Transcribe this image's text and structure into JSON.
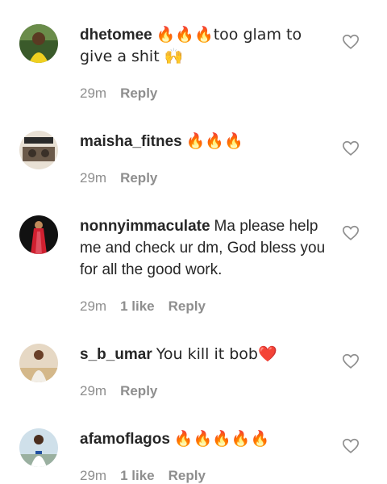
{
  "comments": [
    {
      "username": "dhetomee",
      "text": "🔥🔥🔥too glam to give a shit 🙌",
      "time": "29m",
      "likes": "",
      "reply": "Reply",
      "avatar_icon": "profile-photo-avatar"
    },
    {
      "username": "maisha_fitnes",
      "text": "🔥🔥🔥",
      "time": "29m",
      "likes": "",
      "reply": "Reply",
      "avatar_icon": "profile-photo-avatar"
    },
    {
      "username": "nonnyimmaculate",
      "text": "Ma please help me and check ur dm, God bless you for all the good work.",
      "time": "29m",
      "likes": "1 like",
      "reply": "Reply",
      "avatar_icon": "profile-photo-avatar"
    },
    {
      "username": "s_b_umar",
      "text": "You kill it bob❤️",
      "time": "29m",
      "likes": "",
      "reply": "Reply",
      "avatar_icon": "profile-photo-avatar"
    },
    {
      "username": "afamoflagos",
      "text": "🔥🔥🔥🔥🔥",
      "time": "29m",
      "likes": "1 like",
      "reply": "Reply",
      "avatar_icon": "profile-photo-avatar"
    }
  ],
  "colors": {
    "text": "#262626",
    "meta": "#8e8e8e",
    "heart_outline": "#8e8e8e"
  },
  "icons": {
    "like": "heart-outline-icon"
  }
}
